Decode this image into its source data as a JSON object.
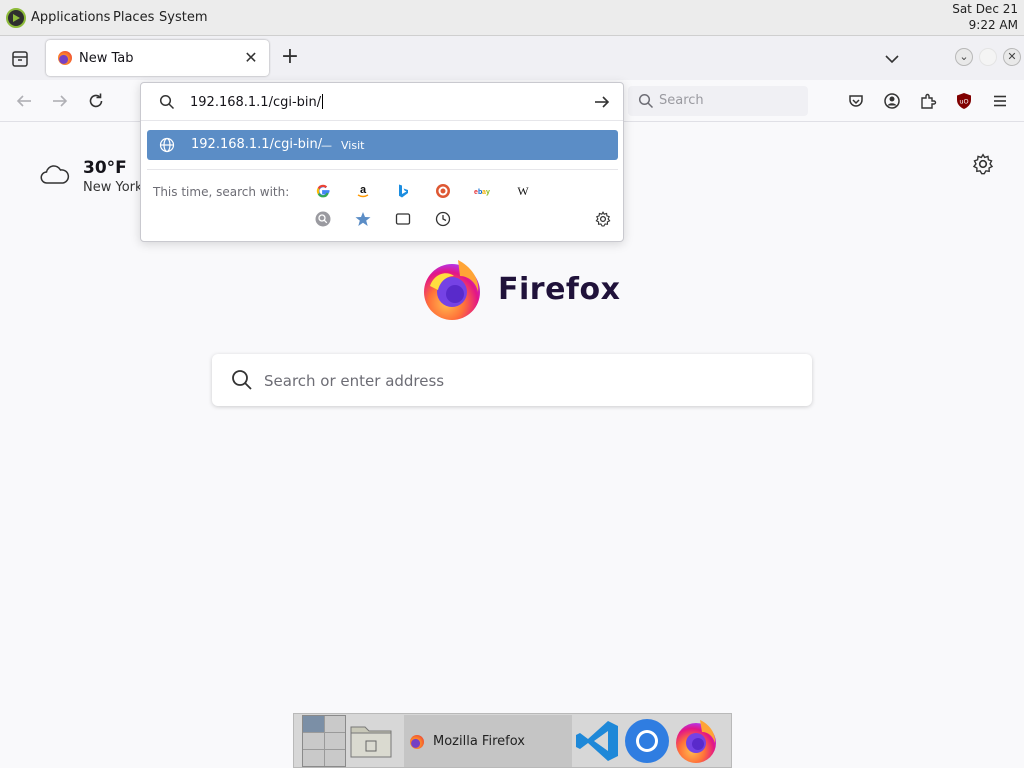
{
  "system_panel": {
    "menus": [
      "Applications",
      "Places",
      "System"
    ],
    "date": "Sat Dec 21",
    "time": "9:22 AM"
  },
  "tabs": [
    {
      "title": "New Tab",
      "active": true
    }
  ],
  "navbar": {
    "search_placeholder": "Search"
  },
  "urlbar": {
    "value": "192.168.1.1/cgi-bin/",
    "suggestion": {
      "url": "192.168.1.1/cgi-bin/",
      "separator": "—",
      "action": "Visit"
    },
    "oneoff_label": "This time, search with:",
    "engines": [
      "google-icon",
      "amazon-icon",
      "bing-icon",
      "duckduckgo-icon",
      "ebay-icon",
      "wikipedia-icon"
    ],
    "modes": [
      "search-icon",
      "bookmarks-star-icon",
      "tabs-icon",
      "history-clock-icon"
    ]
  },
  "weather": {
    "temperature": "30°F",
    "city": "New York"
  },
  "brand": {
    "wordmark": "Firefox"
  },
  "content_search": {
    "placeholder": "Search or enter address"
  },
  "taskbar": {
    "task_label": "Mozilla Firefox",
    "apps": [
      "file-manager-icon",
      "vscode-icon",
      "chromium-icon",
      "firefox-icon"
    ]
  },
  "colors": {
    "suggestion_highlight": "#5b8dc6",
    "firefox_purple": "#20123a"
  }
}
